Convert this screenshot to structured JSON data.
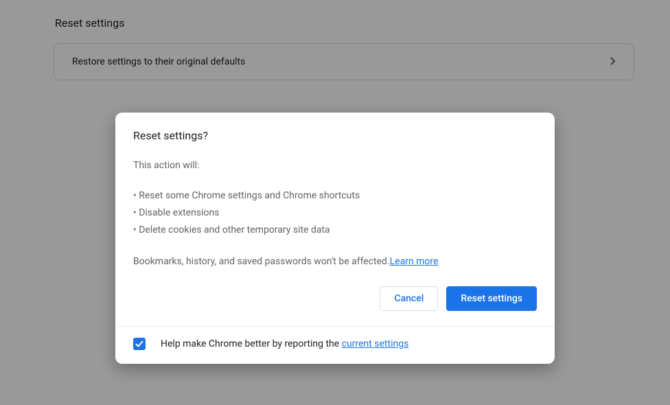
{
  "section": {
    "title": "Reset settings",
    "restore_row": {
      "label": "Restore settings to their original defaults"
    }
  },
  "dialog": {
    "title": "Reset settings?",
    "lead": "This action will:",
    "bullets": [
      "Reset some Chrome settings and Chrome shortcuts",
      "Disable extensions",
      "Delete cookies and other temporary site data"
    ],
    "note_text": "Bookmarks, history, and saved passwords won't be affected.",
    "learn_more": "Learn more",
    "cancel_label": "Cancel",
    "confirm_label": "Reset settings",
    "footer": {
      "checked": true,
      "prefix": "Help make Chrome better by reporting the ",
      "link": "current settings"
    }
  }
}
